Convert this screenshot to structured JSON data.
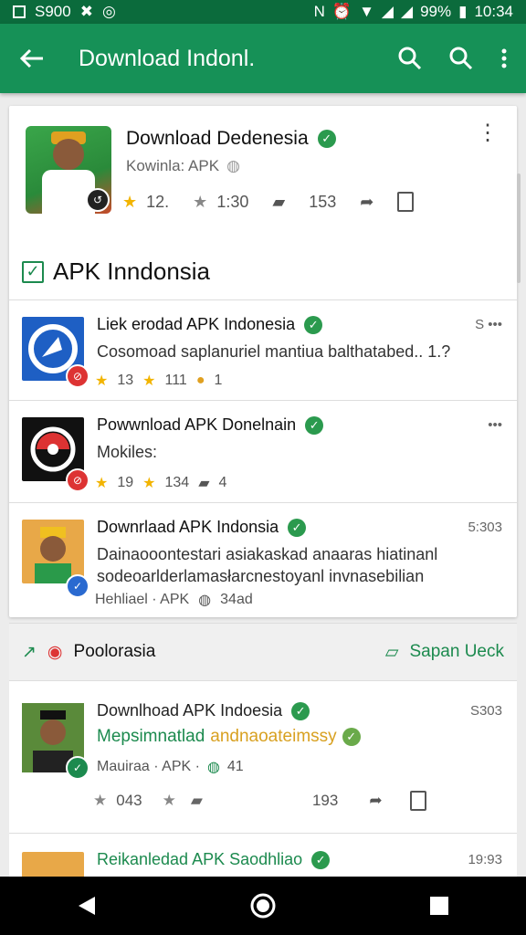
{
  "status_bar": {
    "left_text": "S900",
    "battery": "99%",
    "time": "10:34"
  },
  "app_bar": {
    "title": "Download Indonl."
  },
  "hero": {
    "title": "Download Dedenesia",
    "subtitle": "Kowinla: APK",
    "stats": [
      "12.",
      "1:30",
      "153"
    ]
  },
  "section": {
    "title": "APK Inndonsia"
  },
  "list": [
    {
      "title": "Liek erodad APK Indonesia",
      "desc": "Cosomoad saplanuriel mantiua balthatabed.. 1.?",
      "meta": [
        "13",
        "111",
        "1"
      ],
      "time": "S"
    },
    {
      "title": "Powwnload APK Donelnain",
      "desc": "Mokiles:",
      "meta": [
        "19",
        "134",
        "4"
      ],
      "time": ""
    },
    {
      "title": "Downrlaad APK Indonsia",
      "desc": "Dainaooontestari asiakaskad anaaras hiatinanl sodeoarlderlamasłarcnestoyanl invnasebilian",
      "meta": [
        "Hehliael · APK",
        "34ad"
      ],
      "time": "5:303"
    }
  ],
  "divider": {
    "left_label": "Poolorasia",
    "right_label": "Sapan Ueck"
  },
  "post": {
    "title": "Downlhoad APK Indoesia",
    "highlight_dark": "Mepsimnatlad",
    "highlight_light": "andnaoateimssy",
    "meta": "Mauiraa · APK ·",
    "meta_count": "41",
    "stats": [
      "043",
      "193"
    ],
    "time": "S303"
  },
  "next_item": {
    "title": "Reikanledad APK Saodhliao",
    "time": "19:93"
  },
  "colors": {
    "primary": "#169157",
    "status": "#0b6b3c",
    "verified": "#2b9a4e",
    "star": "#f2b400"
  }
}
